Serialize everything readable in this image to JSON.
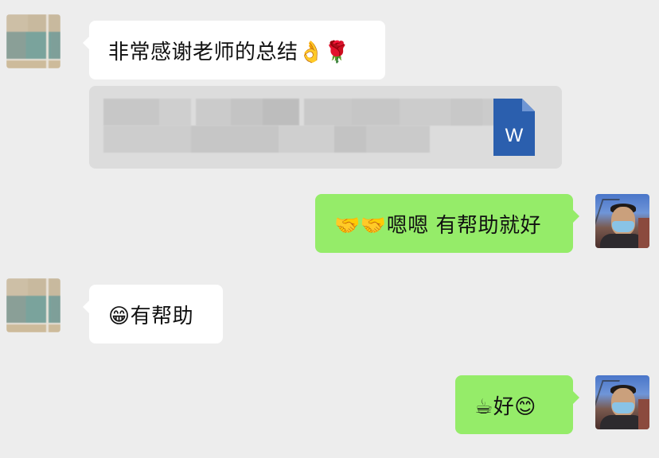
{
  "conversation": {
    "messages": [
      {
        "sender": "other",
        "kind": "text",
        "text": "非常感谢老师的总结👌🌹"
      },
      {
        "sender": "other",
        "kind": "file",
        "file_icon": "word-document-icon",
        "file_icon_letter": "W",
        "file_name_visible": false
      },
      {
        "sender": "self",
        "kind": "text",
        "text": "🤝🤝嗯嗯 有帮助就好"
      },
      {
        "sender": "other",
        "kind": "text",
        "text": "😁有帮助"
      },
      {
        "sender": "self",
        "kind": "text",
        "text": "☕好😊"
      }
    ]
  },
  "colors": {
    "background": "#ededed",
    "other_bubble": "#ffffff",
    "self_bubble": "#95ec69",
    "file_card": "#dcdcdc",
    "word_icon": "#2b5fae"
  }
}
